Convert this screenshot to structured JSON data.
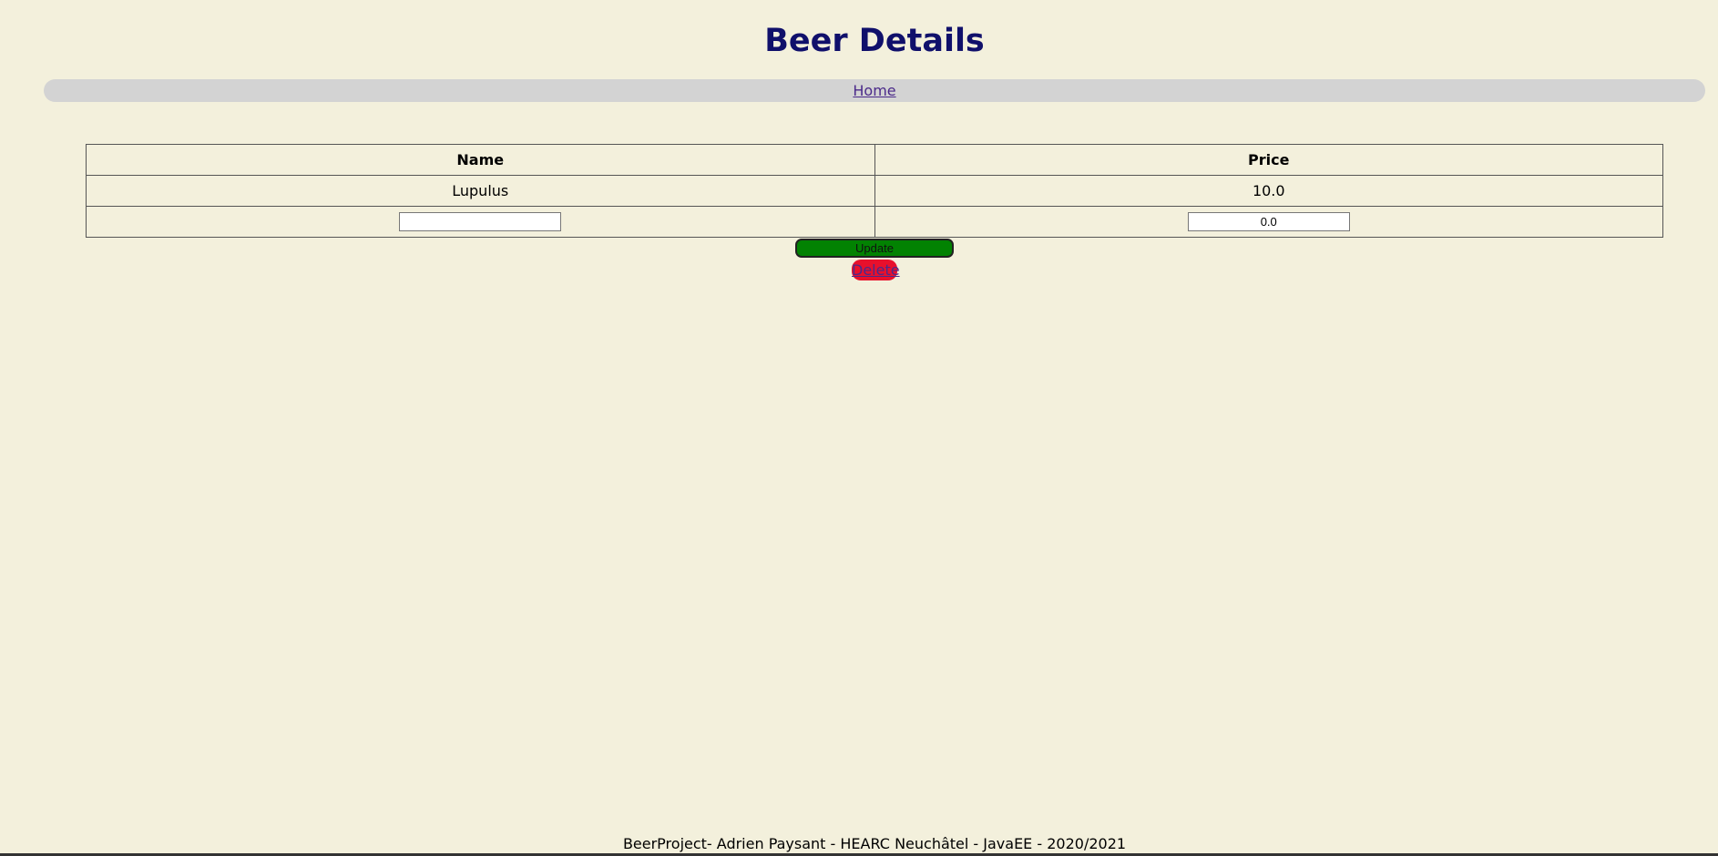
{
  "header": {
    "title": "Beer Details"
  },
  "nav": {
    "home_label": "Home"
  },
  "table": {
    "columns": [
      "Name",
      "Price"
    ],
    "row": {
      "name": "Lupulus",
      "price": "10.0"
    },
    "inputs": {
      "name_value": "",
      "price_value": "0.0"
    }
  },
  "actions": {
    "update_label": "Update",
    "delete_label": "Delete"
  },
  "footer": {
    "text": "BeerProject- Adrien Paysant - HEARC Neuchâtel - JavaEE - 2020/2021"
  },
  "colors": {
    "background": "#f3f0dc",
    "title": "#10106b",
    "nav": "#d3d3d3",
    "update": "#028202",
    "delete": "#e8102c"
  }
}
